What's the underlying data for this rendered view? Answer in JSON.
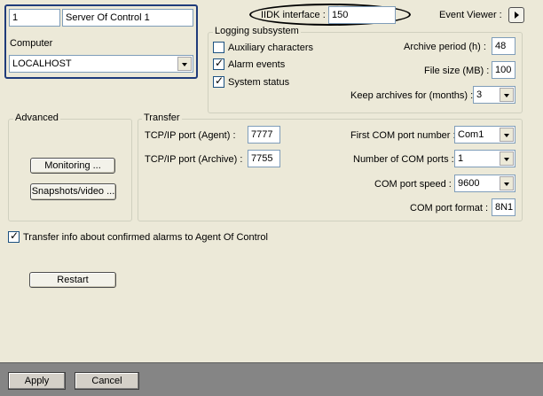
{
  "header": {
    "id_value": "1",
    "name_value": "Server Of Control 1",
    "computer_label": "Computer",
    "computer_value": "LOCALHOST",
    "iidk_label": "IIDK interface :",
    "iidk_value": "150",
    "event_viewer_label": "Event Viewer :"
  },
  "logging": {
    "title": "Logging subsystem",
    "checkboxes": [
      {
        "label": "Auxiliary characters",
        "checked": false
      },
      {
        "label": "Alarm events",
        "checked": true
      },
      {
        "label": "System status",
        "checked": true
      }
    ],
    "archive_period_label": "Archive period (h) :",
    "archive_period_value": "48",
    "file_size_label": "File size (MB) :",
    "file_size_value": "100",
    "keep_archives_label": "Keep archives for (months) :",
    "keep_archives_value": "3"
  },
  "advanced": {
    "title": "Advanced",
    "monitoring_button": "Monitoring ...",
    "snapshots_button": "Snapshots/video ..."
  },
  "transfer": {
    "title": "Transfer",
    "tcp_agent_label": "TCP/IP port (Agent) :",
    "tcp_agent_value": "7777",
    "tcp_archive_label": "TCP/IP port (Archive) :",
    "tcp_archive_value": "7755",
    "first_com_label": "First COM port number :",
    "first_com_value": "Com1",
    "num_com_label": "Number of COM ports :",
    "num_com_value": "1",
    "com_speed_label": "COM port speed :",
    "com_speed_value": "9600",
    "com_format_label": "COM port format :",
    "com_format_value": "8N1"
  },
  "transfer_info": {
    "label": "Transfer info about confirmed alarms to Agent Of Control",
    "checked": true
  },
  "restart_button": "Restart",
  "footer": {
    "apply_button": "Apply",
    "cancel_button": "Cancel"
  },
  "checkmark_glyph": "✓",
  "colors": {
    "panel": "#ece9d8",
    "footer": "#858585",
    "header_border": "#1f3b7a",
    "highlight_oval": "#000000"
  }
}
